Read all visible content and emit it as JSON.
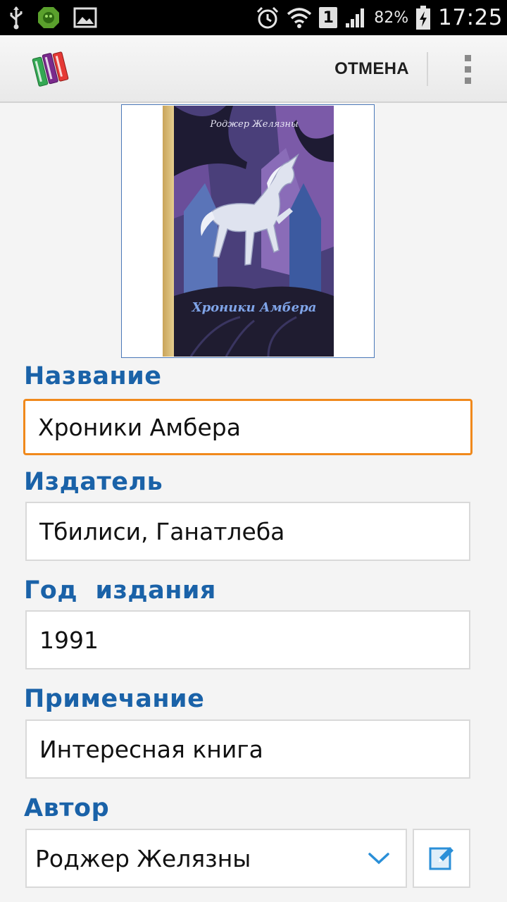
{
  "status_bar": {
    "time": "17:25",
    "battery_percent": "82%",
    "sim_slot": "1",
    "icons": [
      "usb-icon",
      "shield-app-icon",
      "image-icon",
      "alarm-icon",
      "wifi-icon",
      "signal-icon",
      "battery-charging-icon"
    ]
  },
  "action_bar": {
    "logo": "books-logo-icon",
    "cancel_label": "ОТМЕНА",
    "overflow": "overflow-menu-icon"
  },
  "cover": {
    "book_author": "Роджер Желязны",
    "book_title": "Хроники Амбера"
  },
  "form": {
    "title_label": "Название",
    "title_value": "Хроники Амбера",
    "publisher_label": "Издатель",
    "publisher_value": "Тбилиси, Ганатлеба",
    "year_label": "Год  издания",
    "year_value": "1991",
    "note_label": "Примечание",
    "note_value": "Интересная книга",
    "author_label": "Автор",
    "author_value": "Роджер Желязны"
  },
  "colors": {
    "label_blue": "#1a62a8",
    "focus_orange": "#f0891c",
    "accent_icon_blue": "#2a8fd8"
  }
}
